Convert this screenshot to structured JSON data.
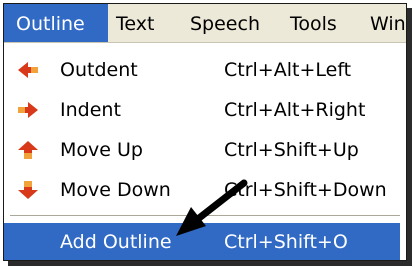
{
  "menubar": {
    "items": [
      {
        "label": "Outline",
        "active": true
      },
      {
        "label": "Text"
      },
      {
        "label": "Speech"
      },
      {
        "label": "Tools"
      },
      {
        "label": "Wind"
      }
    ]
  },
  "menu": {
    "items": [
      {
        "label": "Outdent",
        "shortcut": "Ctrl+Alt+Left",
        "icon": "arrow-left-icon"
      },
      {
        "label": "Indent",
        "shortcut": "Ctrl+Alt+Right",
        "icon": "arrow-right-icon"
      },
      {
        "label": "Move Up",
        "shortcut": "Ctrl+Shift+Up",
        "icon": "arrow-up-icon"
      },
      {
        "label": "Move Down",
        "shortcut": "Ctrl+Shift+Down",
        "icon": "arrow-down-icon"
      },
      {
        "label": "Add Outline",
        "shortcut": "Ctrl+Shift+O",
        "highlighted": true
      }
    ]
  },
  "colors": {
    "highlight": "#316ac5",
    "menubar_bg": "#ece9d8",
    "icon_red": "#d8391b",
    "icon_orange": "#f2a23a"
  }
}
